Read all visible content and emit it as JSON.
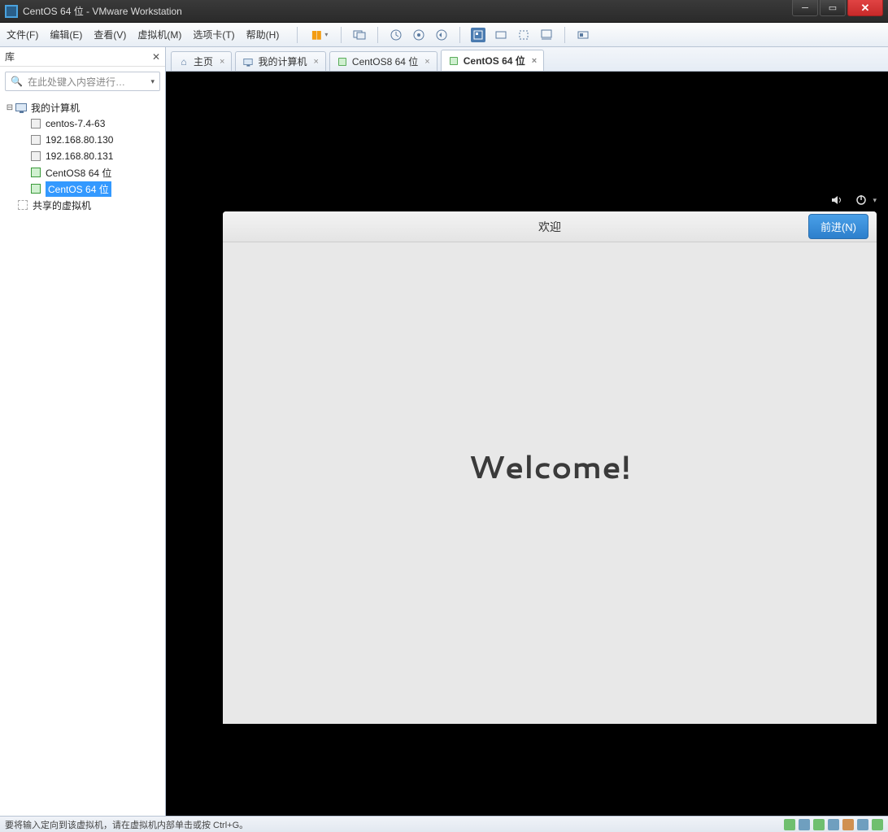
{
  "window": {
    "title": "CentOS 64 位 - VMware Workstation"
  },
  "menubar": {
    "file": "文件(F)",
    "edit": "编辑(E)",
    "view": "查看(V)",
    "vm": "虚拟机(M)",
    "tabs": "选项卡(T)",
    "help": "帮助(H)"
  },
  "sidebar": {
    "header": "库",
    "search_placeholder": "在此处键入内容进行…",
    "root": "我的计算机",
    "vms": [
      "centos-7.4-63",
      "192.168.80.130",
      "192.168.80.131",
      "CentOS8 64 位",
      "CentOS 64 位"
    ],
    "shared": "共享的虚拟机"
  },
  "tabs": {
    "home": "主页",
    "mycomputer": "我的计算机",
    "centos8": "CentOS8 64 位",
    "centos": "CentOS 64 位"
  },
  "guest": {
    "dialog_title": "欢迎",
    "next_button": "前进(N)",
    "welcome": "Welcome!"
  },
  "statusbar": {
    "text": "要将输入定向到该虚拟机，请在虚拟机内部单击或按 Ctrl+G。"
  }
}
